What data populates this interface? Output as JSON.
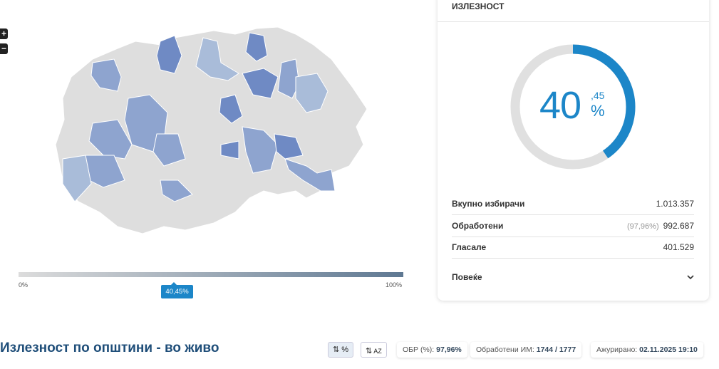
{
  "map": {
    "zoom_in": "+",
    "zoom_out": "−",
    "colors": {
      "none": "#dedede",
      "low": "#a9bcd9",
      "mid": "#8ea4cf",
      "high": "#6f8ac4"
    }
  },
  "legend": {
    "min_label": "0%",
    "max_label": "100%",
    "marker_label": "40,45%",
    "marker_value": 40.45
  },
  "card": {
    "title": "ИЗЛЕЗНОСТ",
    "gauge": {
      "value": 40.45,
      "integer": "40",
      "decimal": ",45",
      "unit": "%",
      "color": "#1c86c8",
      "track": "#e0e0e0"
    },
    "rows": [
      {
        "label": "Вкупно избирачи",
        "value": "1.013.357"
      },
      {
        "label": "Обработени",
        "sub": "(97,96%)",
        "value": "992.687"
      },
      {
        "label": "Гласале",
        "value": "401.529"
      }
    ],
    "more_label": "Повеќе"
  },
  "section": {
    "title": "Излезност по општини - во живо",
    "sort_pct": "%",
    "sort_az": "AZ",
    "obr_label": "ОБР (%):",
    "obr_value": "97,96%",
    "processed_label": "Обработени ИМ:",
    "processed_value": "1744 / 1777",
    "updated_label": "Ажурирано:",
    "updated_value": "02.11.2025 19:10"
  }
}
